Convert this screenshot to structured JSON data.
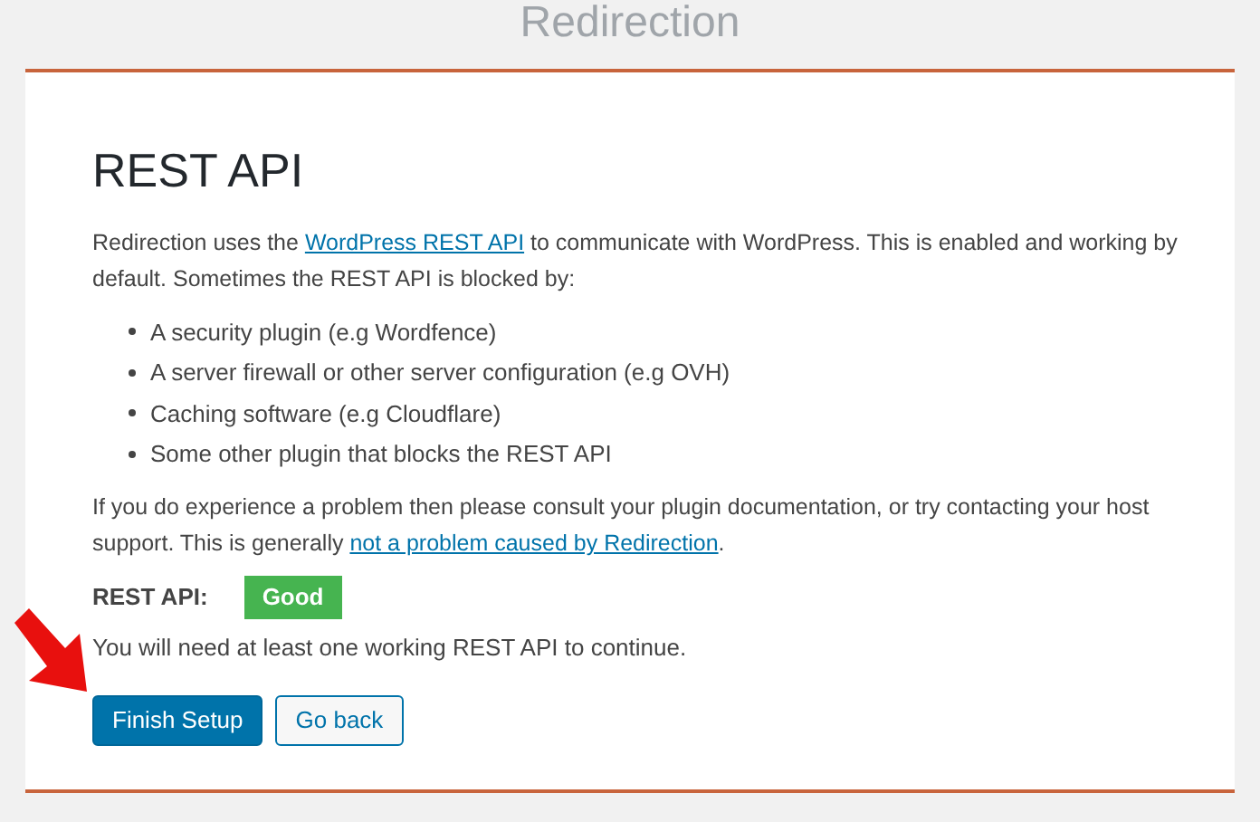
{
  "page_title": "Redirection",
  "card": {
    "heading": "REST API",
    "intro": [
      {
        "text": "Redirection uses the "
      },
      {
        "text": "WordPress REST API",
        "link": true
      },
      {
        "text": " to communicate with WordPress. This is enabled and working by default. Sometimes the REST API is blocked by:"
      }
    ],
    "causes": [
      "A security plugin (e.g Wordfence)",
      "A server firewall or other server configuration (e.g OVH)",
      "Caching software (e.g Cloudflare)",
      "Some other plugin that blocks the REST API"
    ],
    "advice": [
      {
        "text": "If you do experience a problem then please consult your plugin documentation, or try contacting your host support. This is generally "
      },
      {
        "text": "not a problem caused by Redirection",
        "link": true
      },
      {
        "text": "."
      }
    ],
    "status": {
      "label": "REST API:",
      "value": "Good",
      "color": "#46b450"
    },
    "note": "You will need at least one working REST API to continue.",
    "buttons": [
      {
        "label": "Finish Setup",
        "kind": "primary"
      },
      {
        "label": "Go back",
        "kind": "secondary"
      }
    ]
  }
}
